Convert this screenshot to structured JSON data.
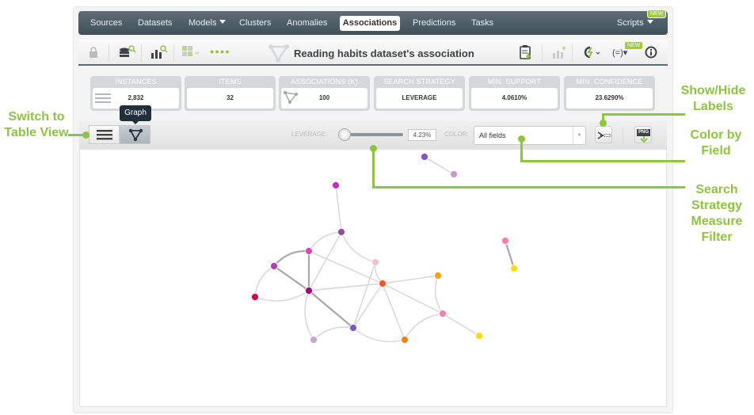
{
  "nav": {
    "items": [
      "Sources",
      "Datasets",
      "Models",
      "Clusters",
      "Anomalies",
      "Associations",
      "Predictions",
      "Tasks"
    ],
    "active": "Associations",
    "scripts_label": "Scripts",
    "new_badge": "NEW"
  },
  "toolbar": {
    "title": "Reading habits dataset's association",
    "status_dots": "●●●●",
    "new_badge": "NEW",
    "icons": [
      "lock-icon",
      "dataset-search-icon",
      "model-search-icon",
      "sample-icon",
      "status-dots-icon",
      "association-icon",
      "report-download-icon",
      "add-chart-icon",
      "workflow-icon",
      "formula-icon",
      "info-icon"
    ]
  },
  "stats": [
    {
      "label": "INSTANCES",
      "value": "2,832"
    },
    {
      "label": "ITEMS",
      "value": "32"
    },
    {
      "label": "ASSOCIATIONS (K)",
      "value": "100"
    },
    {
      "label": "SEARCH STRATEGY",
      "value": "LEVERAGE"
    },
    {
      "label": "MIN. SUPPORT",
      "value": "4.0610%"
    },
    {
      "label": "MIN. CONFIDENCE",
      "value": "23.6290%"
    }
  ],
  "graph_controls": {
    "tooltip": "Graph",
    "leverage_label": "LEVERAGE:",
    "leverage_value": "4.23%",
    "leverage_fraction": 0.0,
    "color_label": "COLOR:",
    "color_selected": "All fields",
    "png_label": "PNG"
  },
  "annotations": {
    "switch_view": "Switch to Table View",
    "show_hide": "Show/Hide Labels",
    "color_by": "Color by Field",
    "search_strategy": "Search Strategy Measure Filter"
  },
  "graph": {
    "nodes": [
      {
        "id": "n1",
        "color": "#7e57c2"
      },
      {
        "id": "n2",
        "color": "#ce93d8"
      },
      {
        "id": "n3",
        "color": "#c030b8"
      },
      {
        "id": "n4",
        "color": "#9a4a9e"
      },
      {
        "id": "n5",
        "color": "#d946b8"
      },
      {
        "id": "n6",
        "color": "#b43cb4"
      },
      {
        "id": "n7",
        "color": "#f8bbd9"
      },
      {
        "id": "n8",
        "color": "#d0064f"
      },
      {
        "id": "n9",
        "color": "#a8007a"
      },
      {
        "id": "n10",
        "color": "#ff5722"
      },
      {
        "id": "n11",
        "color": "#ffa000"
      },
      {
        "id": "n12",
        "color": "#f77eb2"
      },
      {
        "id": "n13",
        "color": "#7e57c2"
      },
      {
        "id": "n14",
        "color": "#cea2d6"
      },
      {
        "id": "n15",
        "color": "#ff7d10"
      },
      {
        "id": "n16",
        "color": "#ffdc00"
      },
      {
        "id": "n17",
        "color": "#f77eb2"
      },
      {
        "id": "n18",
        "color": "#ffdc00"
      }
    ],
    "edges": [
      [
        "n1",
        "n2"
      ],
      [
        "n3",
        "n4"
      ],
      [
        "n4",
        "n5"
      ],
      [
        "n4",
        "n9"
      ],
      [
        "n4",
        "n7"
      ],
      [
        "n5",
        "n6"
      ],
      [
        "n5",
        "n9"
      ],
      [
        "n6",
        "n9"
      ],
      [
        "n6",
        "n8"
      ],
      [
        "n8",
        "n9"
      ],
      [
        "n5",
        "n10"
      ],
      [
        "n9",
        "n10"
      ],
      [
        "n9",
        "n13"
      ],
      [
        "n9",
        "n14"
      ],
      [
        "n7",
        "n10"
      ],
      [
        "n7",
        "n13"
      ],
      [
        "n10",
        "n11"
      ],
      [
        "n10",
        "n12"
      ],
      [
        "n10",
        "n15"
      ],
      [
        "n10",
        "n13"
      ],
      [
        "n11",
        "n12"
      ],
      [
        "n12",
        "n15"
      ],
      [
        "n12",
        "n16"
      ],
      [
        "n13",
        "n14"
      ],
      [
        "n13",
        "n15"
      ],
      [
        "n17",
        "n18"
      ]
    ]
  }
}
